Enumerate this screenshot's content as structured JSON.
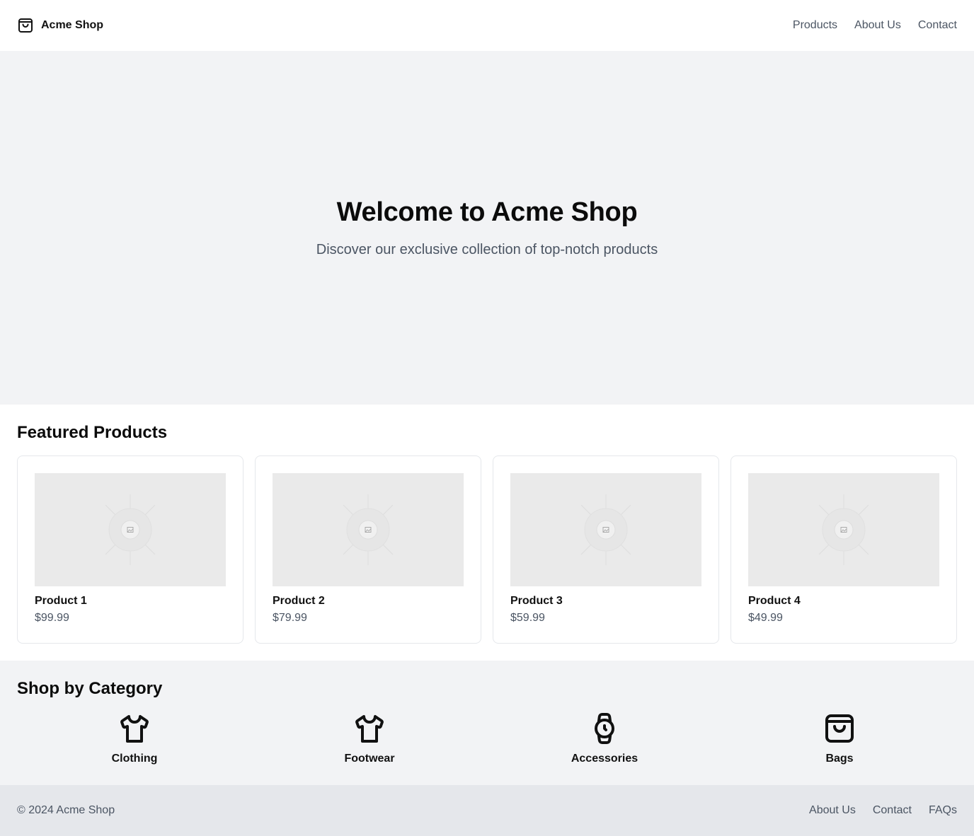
{
  "header": {
    "brand_name": "Acme Shop",
    "brand_icon": "shopping-bag-icon",
    "nav": [
      "Products",
      "About Us",
      "Contact"
    ]
  },
  "hero": {
    "title": "Welcome to Acme Shop",
    "subtitle": "Discover our exclusive collection of top-notch products"
  },
  "featured": {
    "title": "Featured Products",
    "products": [
      {
        "name": "Product 1",
        "price": "$99.99"
      },
      {
        "name": "Product 2",
        "price": "$79.99"
      },
      {
        "name": "Product 3",
        "price": "$59.99"
      },
      {
        "name": "Product 4",
        "price": "$49.99"
      }
    ]
  },
  "categories": {
    "title": "Shop by Category",
    "items": [
      {
        "label": "Clothing",
        "icon": "shirt-icon"
      },
      {
        "label": "Footwear",
        "icon": "shirt-icon"
      },
      {
        "label": "Accessories",
        "icon": "watch-icon"
      },
      {
        "label": "Bags",
        "icon": "shopping-bag-icon"
      }
    ]
  },
  "footer": {
    "copyright": "© 2024 Acme Shop",
    "links": [
      "About Us",
      "Contact",
      "FAQs"
    ]
  },
  "colors": {
    "hero_bg": "#f2f3f5",
    "footer_bg": "#e5e7eb",
    "muted_text": "#4b5563",
    "placeholder_bg": "#eaeaea"
  }
}
